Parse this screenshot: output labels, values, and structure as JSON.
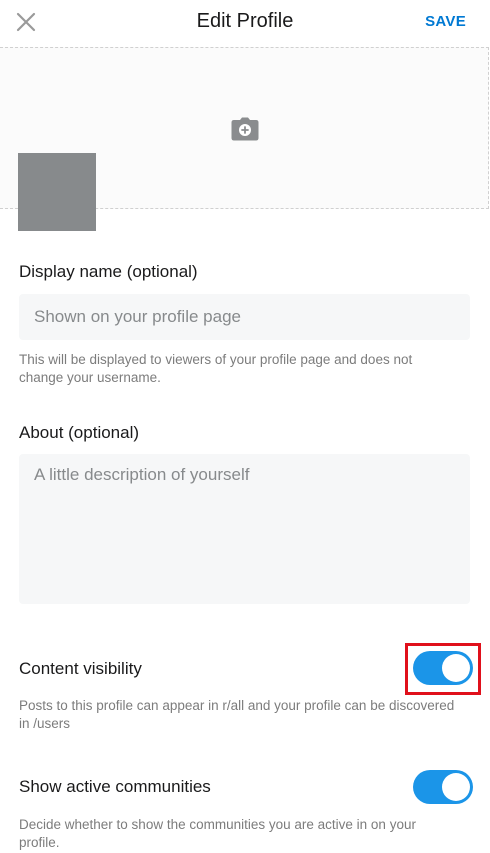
{
  "header": {
    "title": "Edit Profile",
    "save_label": "SAVE",
    "close_icon": "close-icon",
    "accent_color": "#0079d3"
  },
  "banner": {
    "camera_icon": "camera-add-icon"
  },
  "display_name": {
    "label": "Display name (optional)",
    "value": "",
    "placeholder": "Shown on your profile page",
    "help": "This will be displayed to viewers of your profile page and does not change your username."
  },
  "about": {
    "label": "About (optional)",
    "value": "",
    "placeholder": "A little description of yourself"
  },
  "content_visibility": {
    "label": "Content visibility",
    "enabled": true,
    "help": "Posts to this profile can appear in r/all and your profile can be discovered in /users",
    "highlight_color": "#e0101b"
  },
  "active_communities": {
    "label": "Show active communities",
    "enabled": true,
    "help": "Decide whether to show the communities you are active in on your profile."
  },
  "colors": {
    "toggle_on": "#1b95e8"
  }
}
